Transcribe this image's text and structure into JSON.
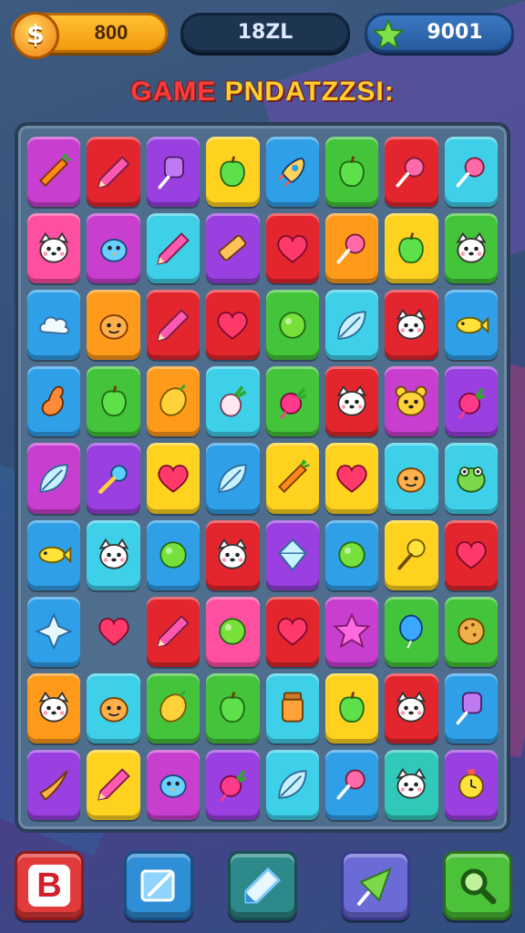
{
  "hud": {
    "coins": "800",
    "center_label": "18ZL",
    "gems": "9001"
  },
  "title": {
    "part1": "GAME",
    "part2": "PNDATZZSI:"
  },
  "colors": {
    "magenta": "#c83fd0",
    "red": "#e3262e",
    "purple": "#9a3fe0",
    "yellow": "#ffd21f",
    "blue": "#2f9fe8",
    "green": "#43c43a",
    "cyan": "#3ed0e8",
    "orange": "#ff9a1a",
    "pink": "#ff4fa0",
    "teal": "#30c8b8"
  },
  "board": [
    [
      "magenta:carrot-icon",
      "red:pencil-icon",
      "purple:bottle-icon",
      "yellow:apple-icon",
      "blue:rocket-icon",
      "green:apple-icon",
      "red:lollipop-icon",
      "cyan:lollipop-icon"
    ],
    [
      "pink:cat-icon",
      "magenta:bird-icon",
      "cyan:pencil-icon",
      "purple:ruler-icon",
      "red:heart-icon",
      "orange:lollipop-icon",
      "yellow:apple-icon",
      "green:cat-icon"
    ],
    [
      "blue:cloud-icon",
      "orange:blob-icon",
      "red:pencil-icon",
      "red:heart-icon",
      "green:ball-icon",
      "cyan:leaf-icon",
      "red:cat-icon",
      "blue:fish-icon"
    ],
    [
      "blue:bowling-icon",
      "green:apple-icon",
      "orange:lemon-icon",
      "cyan:turnip-icon",
      "green:radish-icon",
      "red:cat-icon",
      "magenta:bear-icon",
      "purple:radish-icon"
    ],
    [
      "magenta:leaf-icon",
      "purple:key-icon",
      "yellow:heart-icon",
      "blue:leaf-icon",
      "yellow:carrot-icon",
      "yellow:heart-icon",
      "cyan:blob-icon",
      "cyan:frog-icon"
    ],
    [
      "blue:fish-icon",
      "cyan:cat-icon",
      "blue:ball-icon",
      "red:cat-icon",
      "purple:diamond-icon",
      "blue:ball-icon",
      "yellow:pin-icon",
      "red:heart-icon"
    ],
    [
      "blue:star4-icon",
      "empty:heart-icon",
      "red:pencil-icon",
      "pink:ball-icon",
      "red:heart-icon",
      "magenta:star-icon",
      "green:balloon-icon",
      "green:cookie-icon"
    ],
    [
      "orange:cat-icon",
      "cyan:blob-icon",
      "green:lemon-icon",
      "green:apple-icon",
      "cyan:jar-icon",
      "yellow:apple-icon",
      "red:cat-icon",
      "blue:bottle-icon"
    ],
    [
      "purple:horn-icon",
      "yellow:pencil-icon",
      "magenta:bird-icon",
      "purple:radish-icon",
      "cyan:leaf-icon",
      "blue:lollipop-icon",
      "teal:cat-icon",
      "purple:clock-icon"
    ]
  ],
  "controls": {
    "b_label": "B"
  }
}
